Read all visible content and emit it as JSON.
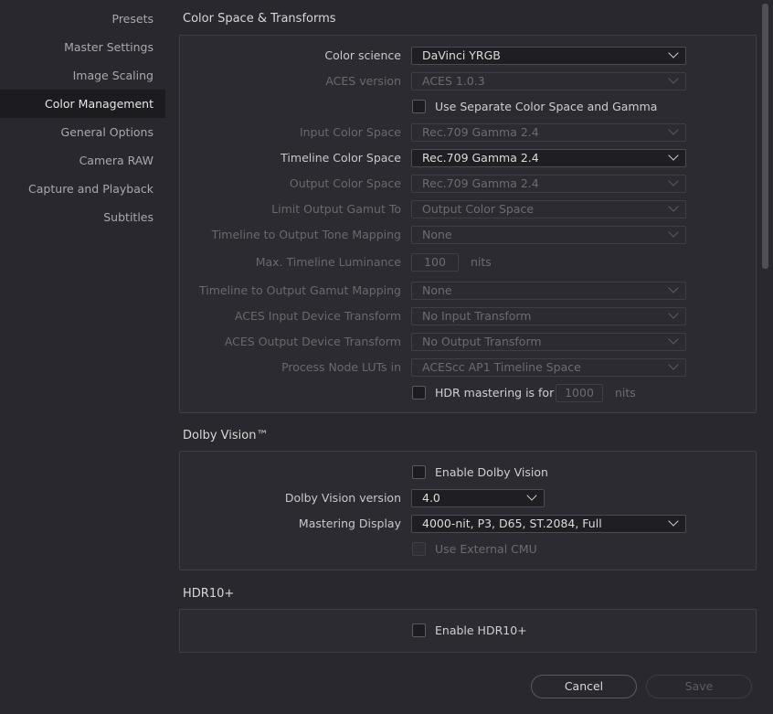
{
  "sidebar": {
    "items": [
      {
        "label": "Presets"
      },
      {
        "label": "Master Settings"
      },
      {
        "label": "Image Scaling"
      },
      {
        "label": "Color Management"
      },
      {
        "label": "General Options"
      },
      {
        "label": "Camera RAW"
      },
      {
        "label": "Capture and Playback"
      },
      {
        "label": "Subtitles"
      }
    ],
    "active_index": 3
  },
  "color_space": {
    "title": "Color Space & Transforms",
    "color_science": {
      "label": "Color science",
      "value": "DaVinci YRGB"
    },
    "aces_version": {
      "label": "ACES version",
      "value": "ACES 1.0.3"
    },
    "separate_cs_gamma": {
      "label": "Use Separate Color Space and Gamma",
      "checked": false
    },
    "input_color_space": {
      "label": "Input Color Space",
      "value": "Rec.709 Gamma 2.4"
    },
    "timeline_color_space": {
      "label": "Timeline Color Space",
      "value": "Rec.709 Gamma 2.4"
    },
    "output_color_space": {
      "label": "Output Color Space",
      "value": "Rec.709 Gamma 2.4"
    },
    "limit_output_gamut": {
      "label": "Limit Output Gamut To",
      "value": "Output Color Space"
    },
    "tone_mapping": {
      "label": "Timeline to Output Tone Mapping",
      "value": "None"
    },
    "max_luminance": {
      "label": "Max. Timeline Luminance",
      "value": "100",
      "unit": "nits"
    },
    "gamut_mapping": {
      "label": "Timeline to Output Gamut Mapping",
      "value": "None"
    },
    "aces_idt": {
      "label": "ACES Input Device Transform",
      "value": "No Input Transform"
    },
    "aces_odt": {
      "label": "ACES Output Device Transform",
      "value": "No Output Transform"
    },
    "process_luts": {
      "label": "Process Node LUTs in",
      "value": "ACEScc AP1 Timeline Space"
    },
    "hdr_mastering": {
      "label": "HDR mastering is for",
      "value": "1000",
      "unit": "nits",
      "checked": false
    }
  },
  "dolby": {
    "title": "Dolby Vision™",
    "enable": {
      "label": "Enable Dolby Vision",
      "checked": false
    },
    "version": {
      "label": "Dolby Vision version",
      "value": "4.0"
    },
    "mastering_display": {
      "label": "Mastering Display",
      "value": "4000-nit, P3, D65, ST.2084, Full"
    },
    "external_cmu": {
      "label": "Use External CMU",
      "checked": false
    }
  },
  "hdr10": {
    "title": "HDR10+",
    "enable": {
      "label": "Enable HDR10+",
      "checked": false
    }
  },
  "footer": {
    "cancel_label": "Cancel",
    "save_label": "Save"
  },
  "colors": {
    "background": "#28282e",
    "panel": "#2b2b31",
    "active_sidebar": "#1c1c20"
  }
}
